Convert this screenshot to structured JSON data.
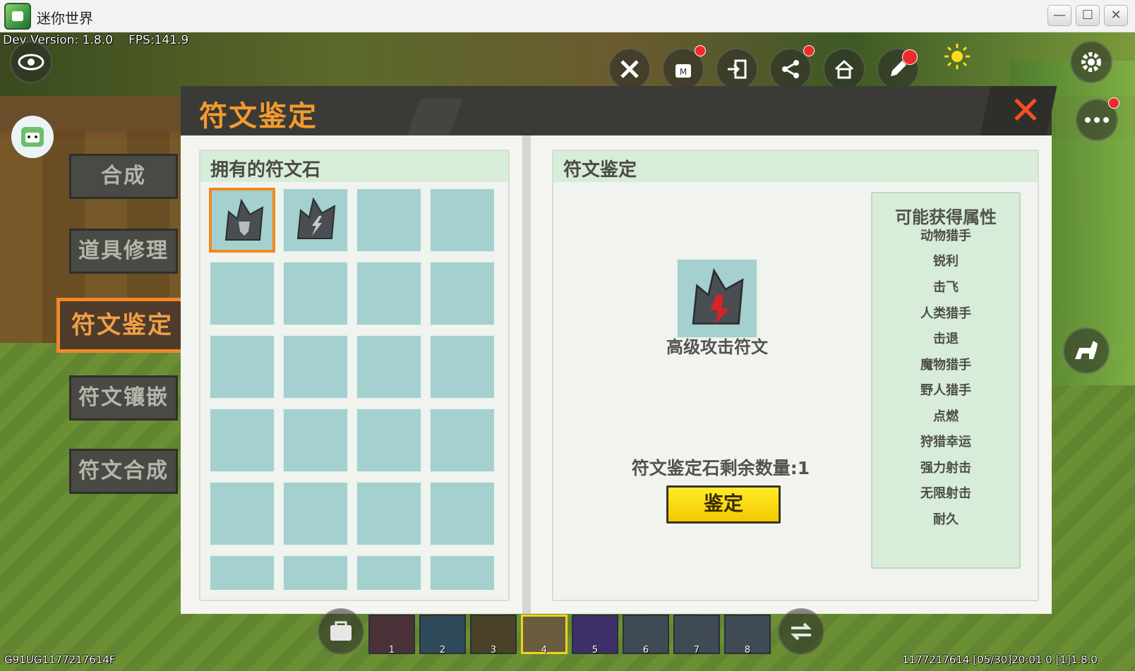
{
  "window": {
    "title": "迷你世界",
    "minimize": "—",
    "maximize": "☐",
    "close": "✕"
  },
  "hud": {
    "dev_version": "Dev Version: 1.8.0",
    "fps": "FPS:141.9",
    "bottom_left_id": "G91UG1177217614F",
    "bottom_right_info": "1177217614   [05/30]20:01 0   [1]1.8.0"
  },
  "nav": [
    {
      "label": "合成",
      "active": false
    },
    {
      "label": "道具修理",
      "active": false
    },
    {
      "label": "符文鉴定",
      "active": true
    },
    {
      "label": "符文镶嵌",
      "active": false
    },
    {
      "label": "符文合成",
      "active": false
    }
  ],
  "panel": {
    "title": "符文鉴定",
    "close_label": "✕",
    "left": {
      "title": "拥有的符文石",
      "slots_filled": [
        "shield-rune",
        "lightning-rune"
      ]
    },
    "right": {
      "title": "符文鉴定",
      "item_name": "高级攻击符文",
      "remaining_label": "符文鉴定石剩余数量:1",
      "identify_button": "鉴定",
      "attributes_title": "可能获得属性",
      "attributes": [
        "动物猎手",
        "锐利",
        "击飞",
        "人类猎手",
        "击退",
        "魔物猎手",
        "野人猎手",
        "点燃",
        "狩猎幸运",
        "强力射击",
        "无限射击",
        "耐久"
      ]
    }
  },
  "hotbar": {
    "numbers": [
      "1",
      "2",
      "3",
      "4",
      "5",
      "6",
      "7",
      "8"
    ],
    "selected": "4"
  },
  "colors": {
    "accent": "#f39a2e",
    "slot": "#a4d0cf",
    "button": "#f4c800",
    "header_bg": "#3a3a36"
  }
}
